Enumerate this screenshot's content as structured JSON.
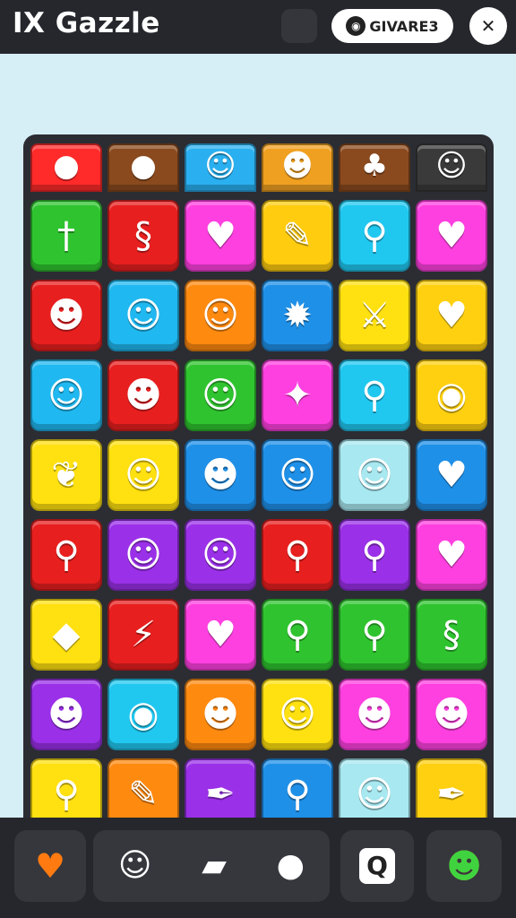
{
  "header": {
    "title": "IX Gazzle",
    "brand_label": "GIVARE3",
    "brand_logo": "◉",
    "close_glyph": "✕"
  },
  "board": {
    "rows": [
      [
        {
          "color": "#ff2a2a",
          "icon": "red-blob-icon",
          "glyph": "●"
        },
        {
          "color": "#8a4a1e",
          "icon": "purple-blob-icon",
          "glyph": "●"
        },
        {
          "color": "#2ab0f0",
          "icon": "white-ghost-icon",
          "glyph": "☺"
        },
        {
          "color": "#f0a020",
          "icon": "cat-face-icon",
          "glyph": "☻"
        },
        {
          "color": "#8a4a1e",
          "icon": "green-tree-icon",
          "glyph": "♣"
        },
        {
          "color": "#3a3a3a",
          "icon": "person-face-icon",
          "glyph": "☺"
        }
      ],
      [
        {
          "color": "#2fc42f",
          "icon": "dagger-icon",
          "glyph": "†"
        },
        {
          "color": "#e81f1f",
          "icon": "green-swirl-icon",
          "glyph": "§"
        },
        {
          "color": "#ff40e0",
          "icon": "heart-icon",
          "glyph": "♥"
        },
        {
          "color": "#ffcc10",
          "icon": "carrot-icon",
          "glyph": "✎"
        },
        {
          "color": "#20c8f0",
          "icon": "lollipop-icon",
          "glyph": "⚲"
        },
        {
          "color": "#ff40e0",
          "icon": "heart-icon",
          "glyph": "♥"
        }
      ],
      [
        {
          "color": "#e81f1f",
          "icon": "lion-face-icon",
          "glyph": "☻"
        },
        {
          "color": "#20b8f0",
          "icon": "chat-bubble-icon",
          "glyph": "☺"
        },
        {
          "color": "#ff8a10",
          "icon": "balloon-icon",
          "glyph": "☺"
        },
        {
          "color": "#1f90e8",
          "icon": "spiky-blob-icon",
          "glyph": "✹"
        },
        {
          "color": "#ffe010",
          "icon": "sword-icon",
          "glyph": "⚔"
        },
        {
          "color": "#ffd010",
          "icon": "broken-heart-icon",
          "glyph": "♥"
        }
      ],
      [
        {
          "color": "#20b8f0",
          "icon": "chat-bubble-icon",
          "glyph": "☺"
        },
        {
          "color": "#e81f1f",
          "icon": "devil-face-icon",
          "glyph": "☻"
        },
        {
          "color": "#2fc42f",
          "icon": "yellow-blob-icon",
          "glyph": "☺"
        },
        {
          "color": "#ff40e0",
          "icon": "wrapped-candy-icon",
          "glyph": "✦"
        },
        {
          "color": "#20c8f0",
          "icon": "lollipop-icon",
          "glyph": "⚲"
        },
        {
          "color": "#ffd010",
          "icon": "ring-icon",
          "glyph": "◉"
        }
      ],
      [
        {
          "color": "#ffe010",
          "icon": "green-leaf-icon",
          "glyph": "❦"
        },
        {
          "color": "#ffe010",
          "icon": "smile-drop-icon",
          "glyph": "☺"
        },
        {
          "color": "#1f90e8",
          "icon": "orange-balloon-icon",
          "glyph": "☻"
        },
        {
          "color": "#1f90e8",
          "icon": "cat-face-icon",
          "glyph": "☺"
        },
        {
          "color": "#a8e8f0",
          "icon": "smile-drop-icon",
          "glyph": "☺"
        },
        {
          "color": "#1f90e8",
          "icon": "blue-heart-icon",
          "glyph": "♥"
        }
      ],
      [
        {
          "color": "#e81f1f",
          "icon": "lollipop-icon",
          "glyph": "⚲"
        },
        {
          "color": "#9a30e8",
          "icon": "green-balloon-icon",
          "glyph": "☺"
        },
        {
          "color": "#9a30e8",
          "icon": "white-cat-icon",
          "glyph": "☺"
        },
        {
          "color": "#e81f1f",
          "icon": "lollipop-icon",
          "glyph": "⚲"
        },
        {
          "color": "#9a30e8",
          "icon": "lollipop-icon",
          "glyph": "⚲"
        },
        {
          "color": "#ff40e0",
          "icon": "purple-heart-icon",
          "glyph": "♥"
        }
      ],
      [
        {
          "color": "#ffe010",
          "icon": "blue-drop-icon",
          "glyph": "◆"
        },
        {
          "color": "#e81f1f",
          "icon": "purple-crystal-icon",
          "glyph": "⚡"
        },
        {
          "color": "#ff40e0",
          "icon": "heart-icon",
          "glyph": "♥"
        },
        {
          "color": "#2fc42f",
          "icon": "orange-lollipop-icon",
          "glyph": "⚲"
        },
        {
          "color": "#2fc42f",
          "icon": "blue-lollipop-icon",
          "glyph": "⚲"
        },
        {
          "color": "#2fc42f",
          "icon": "blue-swirl-icon",
          "glyph": "§"
        }
      ],
      [
        {
          "color": "#9a30e8",
          "icon": "grey-cat-icon",
          "glyph": "☻"
        },
        {
          "color": "#20c8f0",
          "icon": "green-ring-icon",
          "glyph": "◉"
        },
        {
          "color": "#ff8a10",
          "icon": "lion-face-icon",
          "glyph": "☻"
        },
        {
          "color": "#ffe010",
          "icon": "white-cat-icon",
          "glyph": "☺"
        },
        {
          "color": "#ff40e0",
          "icon": "devil-face-icon",
          "glyph": "☻"
        },
        {
          "color": "#ff40e0",
          "icon": "green-monster-icon",
          "glyph": "☻"
        }
      ],
      [
        {
          "color": "#ffe010",
          "icon": "lollipop-icon",
          "glyph": "⚲"
        },
        {
          "color": "#ff8a10",
          "icon": "blue-wrench-icon",
          "glyph": "✎"
        },
        {
          "color": "#9a30e8",
          "icon": "pink-feather-icon",
          "glyph": "✒"
        },
        {
          "color": "#1f90e8",
          "icon": "lollipop-icon",
          "glyph": "⚲"
        },
        {
          "color": "#a8e8f0",
          "icon": "smile-drop-icon",
          "glyph": "☺"
        },
        {
          "color": "#ffd010",
          "icon": "green-leaf-icon",
          "glyph": "✒"
        }
      ]
    ]
  },
  "dock": {
    "left": {
      "icon": "orange-heart-icon",
      "glyph": "♥",
      "color": "#ff7a10"
    },
    "group": [
      {
        "icon": "white-cat-icon",
        "glyph": "☺"
      },
      {
        "icon": "eraser-icon",
        "glyph": "▰"
      },
      {
        "icon": "bomb-icon",
        "glyph": "●"
      }
    ],
    "right1": {
      "icon": "q-badge-icon",
      "glyph": "Q"
    },
    "right2": {
      "icon": "green-sun-monster-icon",
      "glyph": "☻",
      "color": "#ffb010"
    }
  }
}
